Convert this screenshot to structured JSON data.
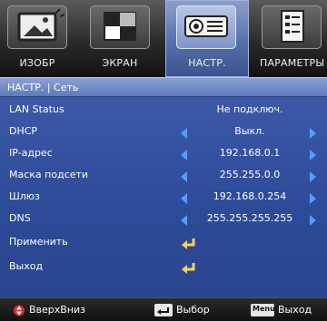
{
  "tabs": [
    {
      "label": "ИЗОБР",
      "icon": "image-icon"
    },
    {
      "label": "ЭКРАН",
      "icon": "screen-icon"
    },
    {
      "label": "НАСТР.",
      "icon": "projector-icon",
      "active": true
    },
    {
      "label": "ПАРАМЕТРЫ",
      "icon": "options-icon"
    }
  ],
  "header": {
    "title": "НАСТР. | Сеть"
  },
  "rows": [
    {
      "name": "LAN Status",
      "value": "Не подключ."
    },
    {
      "name": "DHCP",
      "value": "Выкл."
    },
    {
      "name": "IP-адрес",
      "value": "192.168.0.1"
    },
    {
      "name": "Маска подсети",
      "value": "255.255.0.0"
    },
    {
      "name": "Шлюз",
      "value": "192.168.0.254"
    },
    {
      "name": "DNS",
      "value": "255.255.255.255"
    },
    {
      "name": "Применить"
    },
    {
      "name": "Выход"
    }
  ],
  "footer": {
    "updown_label": "ВверхВниз",
    "select_label": "Выбор",
    "menu_key": "Menu",
    "exit_label": "Выход"
  },
  "colors": {
    "accent_arrow": "#4ea0ff",
    "menu_bg": "#2d4a98",
    "header_bg": "#6f89c6",
    "enter_icon": "#ffd24a"
  }
}
